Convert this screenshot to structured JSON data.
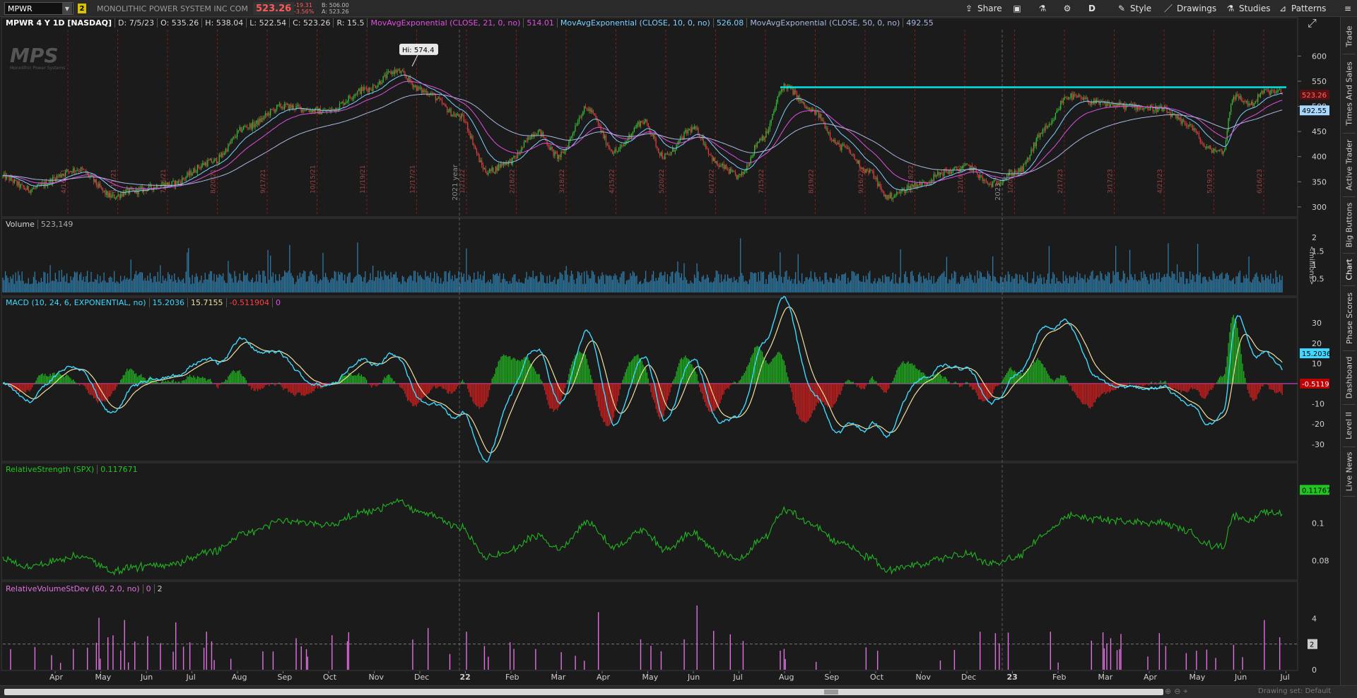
{
  "toolbar": {
    "symbol": "MPWR",
    "link_badge": "2",
    "company": "MONOLITHIC POWER SYSTEM INC COM",
    "last_price": "523.26",
    "change": "-19.31",
    "change_pct": "-3.56%",
    "bid": "B: 506.00",
    "ask": "A: 523.26",
    "buttons": {
      "share": "Share",
      "aggregation": "D",
      "style": "Style",
      "drawings": "Drawings",
      "studies": "Studies",
      "patterns": "Patterns"
    }
  },
  "price_panel": {
    "header": {
      "title": "MPWR 4 Y 1D [NASDAQ]",
      "date": "D: 7/5/23",
      "open": "O: 535.26",
      "high": "H: 538.04",
      "low": "L: 522.54",
      "close": "C: 523.26",
      "range": "R: 15.5",
      "ema21_label": "MovAvgExponential (CLOSE, 21, 0, no)",
      "ema21_value": "514.01",
      "ema10_label": "MovAvgExponential (CLOSE, 10, 0, no)",
      "ema10_value": "526.08",
      "ema50_label": "MovAvgExponential (CLOSE, 50, 0, no)",
      "ema50_value": "492.55"
    },
    "high_callout": "Hi: 574.4",
    "logo_text": "MPS",
    "logo_subtext": "Monolithic Power Systems",
    "y_ticks": [
      "600",
      "550",
      "500",
      "450",
      "400",
      "350",
      "300"
    ],
    "price_badge": "523.26",
    "ema50_badge": "492.55",
    "year_label": "2021 year",
    "year_label_2": "2023",
    "date_markers": [
      "4/16/21",
      "6/11/21",
      "7/16/21",
      "8/20/21",
      "9/17/21",
      "10/15/21",
      "11/19/21",
      "12/17/21",
      "1/21/22",
      "2/18/22",
      "3/18/22",
      "4/15/22",
      "5/20/22",
      "6/17/22",
      "7/15/22",
      "8/19/22",
      "9/16/22",
      "11/18/22",
      "12/16/22",
      "1/20/23",
      "2/17/23",
      "3/17/23",
      "4/21/23",
      "5/19/23",
      "6/16/23"
    ]
  },
  "volume_panel": {
    "label": "Volume",
    "value": "523,149",
    "y_ticks": [
      "2",
      "1.5",
      "1",
      "0.5"
    ],
    "unit": "<millions>"
  },
  "macd_panel": {
    "label": "MACD (10, 24, 6, EXPONENTIAL, no)",
    "value": "15.2036",
    "avg": "15.7155",
    "diff": "-0.511904",
    "zero": "0",
    "y_ticks": [
      "30",
      "20",
      "10",
      "0",
      "-10",
      "-20",
      "-30"
    ],
    "badge_value": "15.2036",
    "badge_diff": "-0.5119"
  },
  "rs_panel": {
    "label": "RelativeStrength (SPX)",
    "value": "0.117671",
    "y_ticks": [
      "0.1",
      "0.08"
    ],
    "badge": "0.11767"
  },
  "rvsd_panel": {
    "label": "RelativeVolumeStDev (60, 2.0, no)",
    "v1": "0",
    "v2": "2",
    "y_ticks": [
      "4",
      "0"
    ],
    "badge": "2"
  },
  "x_axis": {
    "months": [
      "Apr",
      "May",
      "Jun",
      "Jul",
      "Aug",
      "Sep",
      "Oct",
      "Nov",
      "Dec",
      "22",
      "Feb",
      "Mar",
      "Apr",
      "May",
      "Jun",
      "Jul",
      "Aug",
      "Sep",
      "Oct",
      "Nov",
      "Dec",
      "23",
      "Feb",
      "Mar",
      "Apr",
      "May",
      "Jun",
      "Jul"
    ]
  },
  "sidebar": {
    "tabs": [
      "Trade",
      "Times And Sales",
      "Active Trader",
      "Big Buttons",
      "Chart",
      "Phase Scores",
      "Dashboard",
      "Level II",
      "Live News"
    ]
  },
  "bottom": {
    "drawing_set": "Drawing set: Default"
  },
  "colors": {
    "up": "#35c035",
    "down": "#e04040",
    "ema10": "#7ed0ff",
    "ema21": "#e050e0",
    "ema50": "#a8b8e0",
    "resistance": "#00e5e5",
    "macd": "#3fd8ff",
    "signal": "#f0e0a0",
    "rs": "#22b522",
    "volume": "#2f7ca8",
    "rvsd": "#e070e0"
  }
}
